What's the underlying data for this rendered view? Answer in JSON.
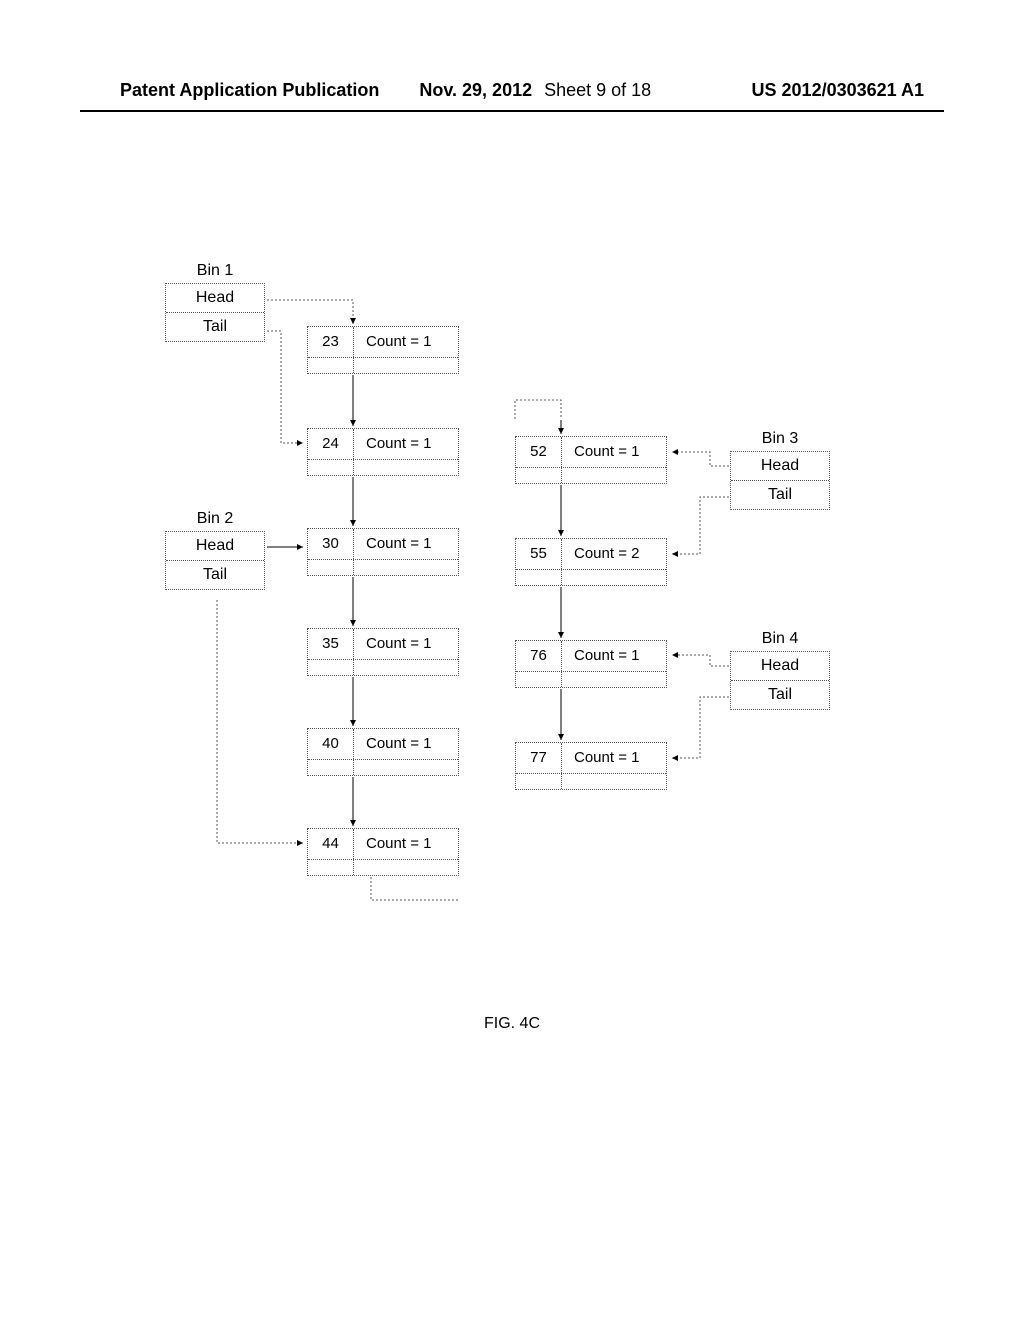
{
  "header": {
    "publication_kind": "Patent Application Publication",
    "date": "Nov. 29, 2012",
    "sheet": "Sheet 9 of 18",
    "publication_number": "US 2012/0303621 A1"
  },
  "figure_label": "FIG. 4C",
  "bins": {
    "b1": {
      "label": "Bin 1",
      "head": "Head",
      "tail": "Tail"
    },
    "b2": {
      "label": "Bin 2",
      "head": "Head",
      "tail": "Tail"
    },
    "b3": {
      "label": "Bin 3",
      "head": "Head",
      "tail": "Tail"
    },
    "b4": {
      "label": "Bin 4",
      "head": "Head",
      "tail": "Tail"
    }
  },
  "nodes": {
    "n23": {
      "value": "23",
      "count_label": "Count = 1"
    },
    "n24": {
      "value": "24",
      "count_label": "Count = 1"
    },
    "n30": {
      "value": "30",
      "count_label": "Count = 1"
    },
    "n35": {
      "value": "35",
      "count_label": "Count = 1"
    },
    "n40": {
      "value": "40",
      "count_label": "Count = 1"
    },
    "n44": {
      "value": "44",
      "count_label": "Count = 1"
    },
    "n52": {
      "value": "52",
      "count_label": "Count = 1"
    },
    "n55": {
      "value": "55",
      "count_label": "Count = 2"
    },
    "n76": {
      "value": "76",
      "count_label": "Count = 1"
    },
    "n77": {
      "value": "77",
      "count_label": "Count = 1"
    }
  }
}
